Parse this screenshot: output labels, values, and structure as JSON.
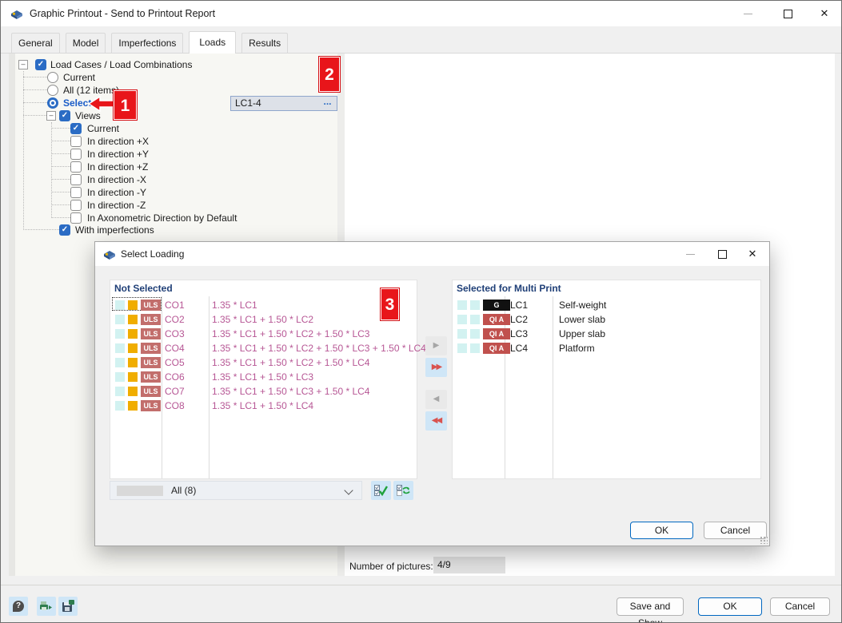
{
  "window": {
    "title": "Graphic Printout - Send to Printout Report"
  },
  "tabs": [
    {
      "label": "General"
    },
    {
      "label": "Model"
    },
    {
      "label": "Imperfections"
    },
    {
      "label": "Loads"
    },
    {
      "label": "Results"
    }
  ],
  "tree": {
    "items": [
      {
        "label": "Load Cases / Load Combinations",
        "state": "checked"
      },
      {
        "label": "Current",
        "state": "radio-off"
      },
      {
        "label": "All (12 items)",
        "state": "radio-off"
      },
      {
        "label": "Select",
        "state": "radio-on"
      },
      {
        "label": "Views",
        "state": "checked"
      },
      {
        "label": "Current",
        "state": "checked"
      },
      {
        "label": "In direction +X",
        "state": "unchecked"
      },
      {
        "label": "In direction +Y",
        "state": "unchecked"
      },
      {
        "label": "In direction +Z",
        "state": "unchecked"
      },
      {
        "label": "In direction -X",
        "state": "unchecked"
      },
      {
        "label": "In direction -Y",
        "state": "unchecked"
      },
      {
        "label": "In direction -Z",
        "state": "unchecked"
      },
      {
        "label": "In Axonometric Direction by Default",
        "state": "unchecked"
      },
      {
        "label": "With imperfections",
        "state": "checked"
      }
    ]
  },
  "lc_field": {
    "value": "LC1-4",
    "ellipsis": "..."
  },
  "annotations": {
    "one": "1",
    "two": "2",
    "three": "3"
  },
  "select_loading": {
    "title": "Select Loading",
    "not_selected": {
      "header": "Not Selected",
      "rows": [
        {
          "badge": "ULS",
          "name": "CO1",
          "formula": "1.35 * LC1"
        },
        {
          "badge": "ULS",
          "name": "CO2",
          "formula": "1.35 * LC1 + 1.50 * LC2"
        },
        {
          "badge": "ULS",
          "name": "CO3",
          "formula": "1.35 * LC1 + 1.50 * LC2 + 1.50 * LC3"
        },
        {
          "badge": "ULS",
          "name": "CO4",
          "formula": "1.35 * LC1 + 1.50 * LC2 + 1.50 * LC3 + 1.50 * LC4"
        },
        {
          "badge": "ULS",
          "name": "CO5",
          "formula": "1.35 * LC1 + 1.50 * LC2 + 1.50 * LC4"
        },
        {
          "badge": "ULS",
          "name": "CO6",
          "formula": "1.35 * LC1 + 1.50 * LC3"
        },
        {
          "badge": "ULS",
          "name": "CO7",
          "formula": "1.35 * LC1 + 1.50 * LC3 + 1.50 * LC4"
        },
        {
          "badge": "ULS",
          "name": "CO8",
          "formula": "1.35 * LC1 + 1.50 * LC4"
        }
      ]
    },
    "selected": {
      "header": "Selected for Multi Print",
      "rows": [
        {
          "badge": "G",
          "name": "LC1",
          "description": "Self-weight"
        },
        {
          "badge": "QI A",
          "name": "LC2",
          "description": "Lower slab"
        },
        {
          "badge": "QI A",
          "name": "LC3",
          "description": "Upper slab"
        },
        {
          "badge": "QI A",
          "name": "LC4",
          "description": "Platform"
        }
      ]
    },
    "filter": {
      "label": "All (8)"
    },
    "buttons": {
      "ok": "OK",
      "cancel": "Cancel"
    }
  },
  "footer": {
    "pictures_label": "Number of pictures:",
    "pictures_value": "4/9",
    "save_and_show": "Save and Show",
    "ok": "OK",
    "cancel": "Cancel"
  },
  "icons": {
    "close": "✕",
    "arrow_right": "▶",
    "arrow_right_double": "▶▶",
    "arrow_left": "◀",
    "arrow_left_double": "◀◀",
    "question": "?"
  },
  "colors": {
    "accent_blue": "#0067c0",
    "annotation_red": "#e8151a",
    "uls_badge": "#c26e6c",
    "qia_badge": "#c0504d",
    "g_badge": "#111111",
    "combination_text": "#b75795",
    "header_navy": "#1f3f77",
    "icon_cyan": "#d2f2f1",
    "icon_yellow": "#f0ad00"
  }
}
